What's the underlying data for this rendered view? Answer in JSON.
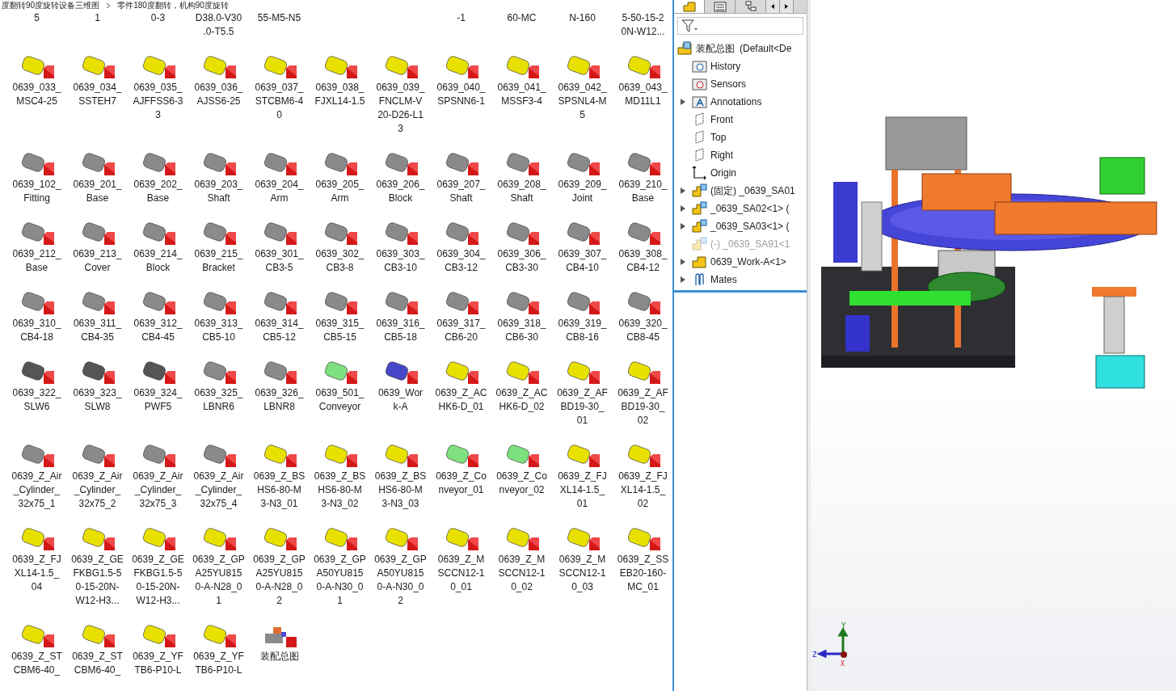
{
  "breadcrumb": [
    "度翻转90度旋转设备三维图",
    "零件180度翻转，机构90度旋转"
  ],
  "partial_row_left": [
    {
      "lines": [
        "5"
      ]
    },
    {
      "lines": [
        "1"
      ]
    },
    {
      "lines": [
        "0-3"
      ]
    },
    {
      "lines": [
        "D38.0-V30",
        ".0-T5.5"
      ]
    },
    {
      "lines": [
        "55-M5-N5"
      ]
    }
  ],
  "partial_row_right": [
    {
      "lines": [
        "-1"
      ]
    },
    {
      "lines": [
        "60-MC"
      ]
    },
    {
      "lines": [
        "N-160"
      ]
    },
    {
      "lines": [
        "5-50-15-2",
        "0N-W12..."
      ]
    }
  ],
  "files": [
    {
      "kind": "part",
      "color": "#e8e000",
      "lines": [
        "0639_033_",
        "MSC4-25"
      ]
    },
    {
      "kind": "part",
      "color": "#e8e000",
      "lines": [
        "0639_034_",
        "SSTEH7"
      ]
    },
    {
      "kind": "part",
      "color": "#e8e000",
      "lines": [
        "0639_035_",
        "AJFFSS6-3",
        "3"
      ]
    },
    {
      "kind": "part",
      "color": "#e8e000",
      "lines": [
        "0639_036_",
        "AJSS6-25"
      ]
    },
    {
      "kind": "part",
      "color": "#e8e000",
      "lines": [
        "0639_037_",
        "STCBM6-4",
        "0"
      ]
    },
    {
      "kind": "part",
      "color": "#e8e000",
      "lines": [
        "0639_038_",
        "FJXL14-1.5"
      ]
    },
    {
      "kind": "part",
      "color": "#e8e000",
      "lines": [
        "0639_039_",
        "FNCLM-V",
        "20-D26-L1",
        "3"
      ]
    },
    {
      "kind": "part",
      "color": "#e8e000",
      "lines": [
        "0639_040_",
        "SPSNN6-1"
      ]
    },
    {
      "kind": "part",
      "color": "#e8e000",
      "lines": [
        "0639_041_",
        "MSSF3-4"
      ]
    },
    {
      "kind": "part",
      "color": "#e8e000",
      "lines": [
        "0639_042_",
        "SPSNL4-M",
        "5"
      ]
    },
    {
      "kind": "part",
      "color": "#e8e000",
      "lines": [
        "0639_043_",
        "MD11L1"
      ]
    },
    {
      "kind": "part",
      "color": "#8a8a8a",
      "lines": [
        "0639_102_",
        "Fitting"
      ]
    },
    {
      "kind": "part",
      "color": "#8a8a8a",
      "lines": [
        "0639_201_",
        "Base"
      ]
    },
    {
      "kind": "part",
      "color": "#8a8a8a",
      "lines": [
        "0639_202_",
        "Base"
      ]
    },
    {
      "kind": "part",
      "color": "#8a8a8a",
      "lines": [
        "0639_203_",
        "Shaft"
      ]
    },
    {
      "kind": "part",
      "color": "#8a8a8a",
      "lines": [
        "0639_204_",
        "Arm"
      ]
    },
    {
      "kind": "part",
      "color": "#8a8a8a",
      "lines": [
        "0639_205_",
        "Arm"
      ]
    },
    {
      "kind": "part",
      "color": "#8a8a8a",
      "lines": [
        "0639_206_",
        "Block"
      ]
    },
    {
      "kind": "part",
      "color": "#8a8a8a",
      "lines": [
        "0639_207_",
        "Shaft"
      ]
    },
    {
      "kind": "part",
      "color": "#8a8a8a",
      "lines": [
        "0639_208_",
        "Shaft"
      ]
    },
    {
      "kind": "part",
      "color": "#8a8a8a",
      "lines": [
        "0639_209_",
        "Joint"
      ]
    },
    {
      "kind": "part",
      "color": "#8a8a8a",
      "lines": [
        "0639_210_",
        "Base"
      ]
    },
    {
      "kind": "part",
      "color": "#8a8a8a",
      "lines": [
        "0639_212_",
        "Base"
      ]
    },
    {
      "kind": "part",
      "color": "#8a8a8a",
      "lines": [
        "0639_213_",
        "Cover"
      ]
    },
    {
      "kind": "part",
      "color": "#8a8a8a",
      "lines": [
        "0639_214_",
        "Block"
      ]
    },
    {
      "kind": "part",
      "color": "#8a8a8a",
      "lines": [
        "0639_215_",
        "Bracket"
      ]
    },
    {
      "kind": "part",
      "color": "#8a8a8a",
      "lines": [
        "0639_301_",
        "CB3-5"
      ]
    },
    {
      "kind": "part",
      "color": "#8a8a8a",
      "lines": [
        "0639_302_",
        "CB3-8"
      ]
    },
    {
      "kind": "part",
      "color": "#8a8a8a",
      "lines": [
        "0639_303_",
        "CB3-10"
      ]
    },
    {
      "kind": "part",
      "color": "#8a8a8a",
      "lines": [
        "0639_304_",
        "CB3-12"
      ]
    },
    {
      "kind": "part",
      "color": "#8a8a8a",
      "lines": [
        "0639_306_",
        "CB3-30"
      ]
    },
    {
      "kind": "part",
      "color": "#8a8a8a",
      "lines": [
        "0639_307_",
        "CB4-10"
      ]
    },
    {
      "kind": "part",
      "color": "#8a8a8a",
      "lines": [
        "0639_308_",
        "CB4-12"
      ]
    },
    {
      "kind": "part",
      "color": "#8a8a8a",
      "lines": [
        "0639_310_",
        "CB4-18"
      ]
    },
    {
      "kind": "part",
      "color": "#8a8a8a",
      "lines": [
        "0639_311_",
        "CB4-35"
      ]
    },
    {
      "kind": "part",
      "color": "#8a8a8a",
      "lines": [
        "0639_312_",
        "CB4-45"
      ]
    },
    {
      "kind": "part",
      "color": "#8a8a8a",
      "lines": [
        "0639_313_",
        "CB5-10"
      ]
    },
    {
      "kind": "part",
      "color": "#8a8a8a",
      "lines": [
        "0639_314_",
        "CB5-12"
      ]
    },
    {
      "kind": "part",
      "color": "#8a8a8a",
      "lines": [
        "0639_315_",
        "CB5-15"
      ]
    },
    {
      "kind": "part",
      "color": "#8a8a8a",
      "lines": [
        "0639_316_",
        "CB5-18"
      ]
    },
    {
      "kind": "part",
      "color": "#8a8a8a",
      "lines": [
        "0639_317_",
        "CB6-20"
      ]
    },
    {
      "kind": "part",
      "color": "#8a8a8a",
      "lines": [
        "0639_318_",
        "CB6-30"
      ]
    },
    {
      "kind": "part",
      "color": "#8a8a8a",
      "lines": [
        "0639_319_",
        "CB8-16"
      ]
    },
    {
      "kind": "part",
      "color": "#8a8a8a",
      "lines": [
        "0639_320_",
        "CB8-45"
      ]
    },
    {
      "kind": "part",
      "color": "#555555",
      "lines": [
        "0639_322_",
        "SLW6"
      ]
    },
    {
      "kind": "part",
      "color": "#555555",
      "lines": [
        "0639_323_",
        "SLW8"
      ]
    },
    {
      "kind": "part",
      "color": "#555555",
      "lines": [
        "0639_324_",
        "PWF5"
      ]
    },
    {
      "kind": "part",
      "color": "#8a8a8a",
      "lines": [
        "0639_325_",
        "LBNR6"
      ]
    },
    {
      "kind": "part",
      "color": "#8a8a8a",
      "lines": [
        "0639_326_",
        "LBNR8"
      ]
    },
    {
      "kind": "part",
      "color": "#7ee07e",
      "lines": [
        "0639_501_",
        "Conveyor"
      ]
    },
    {
      "kind": "part",
      "color": "#4646c8",
      "lines": [
        "0639_Wor",
        "k-A"
      ]
    },
    {
      "kind": "part",
      "color": "#e8e000",
      "lines": [
        "0639_Z_AC",
        "HK6-D_01"
      ]
    },
    {
      "kind": "part",
      "color": "#e8e000",
      "lines": [
        "0639_Z_AC",
        "HK6-D_02"
      ]
    },
    {
      "kind": "part",
      "color": "#e8e000",
      "lines": [
        "0639_Z_AF",
        "BD19-30_",
        "01"
      ]
    },
    {
      "kind": "part",
      "color": "#e8e000",
      "lines": [
        "0639_Z_AF",
        "BD19-30_",
        "02"
      ]
    },
    {
      "kind": "part",
      "color": "#8a8a8a",
      "lines": [
        "0639_Z_Air",
        "_Cylinder_",
        "32x75_1"
      ]
    },
    {
      "kind": "part",
      "color": "#8a8a8a",
      "lines": [
        "0639_Z_Air",
        "_Cylinder_",
        "32x75_2"
      ]
    },
    {
      "kind": "part",
      "color": "#8a8a8a",
      "lines": [
        "0639_Z_Air",
        "_Cylinder_",
        "32x75_3"
      ]
    },
    {
      "kind": "part",
      "color": "#8a8a8a",
      "lines": [
        "0639_Z_Air",
        "_Cylinder_",
        "32x75_4"
      ]
    },
    {
      "kind": "part",
      "color": "#e8e000",
      "lines": [
        "0639_Z_BS",
        "HS6-80-M",
        "3-N3_01"
      ]
    },
    {
      "kind": "part",
      "color": "#e8e000",
      "lines": [
        "0639_Z_BS",
        "HS6-80-M",
        "3-N3_02"
      ]
    },
    {
      "kind": "part",
      "color": "#e8e000",
      "lines": [
        "0639_Z_BS",
        "HS6-80-M",
        "3-N3_03"
      ]
    },
    {
      "kind": "part",
      "color": "#7ee07e",
      "lines": [
        "0639_Z_Co",
        "nveyor_01"
      ]
    },
    {
      "kind": "part",
      "color": "#7ee07e",
      "lines": [
        "0639_Z_Co",
        "nveyor_02"
      ]
    },
    {
      "kind": "part",
      "color": "#e8e000",
      "lines": [
        "0639_Z_FJ",
        "XL14-1.5_",
        "01"
      ]
    },
    {
      "kind": "part",
      "color": "#e8e000",
      "lines": [
        "0639_Z_FJ",
        "XL14-1.5_",
        "02"
      ]
    },
    {
      "kind": "part",
      "color": "#e8e000",
      "lines": [
        "0639_Z_FJ",
        "XL14-1.5_",
        "04"
      ]
    },
    {
      "kind": "part",
      "color": "#e8e000",
      "lines": [
        "0639_Z_GE",
        "FKBG1.5-5",
        "0-15-20N-",
        "W12-H3..."
      ]
    },
    {
      "kind": "part",
      "color": "#e8e000",
      "lines": [
        "0639_Z_GE",
        "FKBG1.5-5",
        "0-15-20N-",
        "W12-H3..."
      ]
    },
    {
      "kind": "part",
      "color": "#e8e000",
      "lines": [
        "0639_Z_GP",
        "A25YU815",
        "0-A-N28_0",
        "1"
      ]
    },
    {
      "kind": "part",
      "color": "#e8e000",
      "lines": [
        "0639_Z_GP",
        "A25YU815",
        "0-A-N28_0",
        "2"
      ]
    },
    {
      "kind": "part",
      "color": "#e8e000",
      "lines": [
        "0639_Z_GP",
        "A50YU815",
        "0-A-N30_0",
        "1"
      ]
    },
    {
      "kind": "part",
      "color": "#e8e000",
      "lines": [
        "0639_Z_GP",
        "A50YU815",
        "0-A-N30_0",
        "2"
      ]
    },
    {
      "kind": "part",
      "color": "#e8e000",
      "lines": [
        "0639_Z_M",
        "SCCN12-1",
        "0_01"
      ]
    },
    {
      "kind": "part",
      "color": "#e8e000",
      "lines": [
        "0639_Z_M",
        "SCCN12-1",
        "0_02"
      ]
    },
    {
      "kind": "part",
      "color": "#e8e000",
      "lines": [
        "0639_Z_M",
        "SCCN12-1",
        "0_03"
      ]
    },
    {
      "kind": "part",
      "color": "#e8e000",
      "lines": [
        "0639_Z_SS",
        "EB20-160-",
        "MC_01"
      ]
    },
    {
      "kind": "part",
      "color": "#e8e000",
      "lines": [
        "0639_Z_ST",
        "CBM6-40_"
      ]
    },
    {
      "kind": "part",
      "color": "#e8e000",
      "lines": [
        "0639_Z_ST",
        "CBM6-40_"
      ]
    },
    {
      "kind": "part",
      "color": "#e8e000",
      "lines": [
        "0639_Z_YF",
        "TB6-P10-L"
      ]
    },
    {
      "kind": "part",
      "color": "#e8e000",
      "lines": [
        "0639_Z_YF",
        "TB6-P10-L"
      ]
    },
    {
      "kind": "assembly",
      "color": "#8a8a8a",
      "lines": [
        "装配总图"
      ]
    }
  ],
  "tree_tabs": [
    {
      "kind": "feature",
      "selected": true
    },
    {
      "kind": "property",
      "selected": false
    },
    {
      "kind": "config",
      "selected": false
    }
  ],
  "tree_root": {
    "name": "装配总图",
    "config": "(Default<De"
  },
  "tree": [
    {
      "kind": "history",
      "label": "History",
      "expandable": false,
      "suppressed": false
    },
    {
      "kind": "sensors",
      "label": "Sensors",
      "expandable": false,
      "suppressed": false
    },
    {
      "kind": "annotations",
      "label": "Annotations",
      "expandable": true,
      "suppressed": false
    },
    {
      "kind": "plane",
      "label": "Front",
      "expandable": false,
      "suppressed": false
    },
    {
      "kind": "plane",
      "label": "Top",
      "expandable": false,
      "suppressed": false
    },
    {
      "kind": "plane",
      "label": "Right",
      "expandable": false,
      "suppressed": false
    },
    {
      "kind": "origin",
      "label": "Origin",
      "expandable": false,
      "suppressed": false
    },
    {
      "kind": "subassembly",
      "label": "(固定) _0639_SA01",
      "expandable": true,
      "suppressed": false
    },
    {
      "kind": "subassembly",
      "label": "_0639_SA02<1> (",
      "expandable": true,
      "suppressed": false
    },
    {
      "kind": "subassembly",
      "label": "_0639_SA03<1> (",
      "expandable": true,
      "suppressed": false
    },
    {
      "kind": "subassembly",
      "label": "(-) _0639_SA91<1",
      "expandable": false,
      "suppressed": true
    },
    {
      "kind": "part",
      "label": "0639_Work-A<1>",
      "expandable": true,
      "suppressed": false
    },
    {
      "kind": "mates",
      "label": "Mates",
      "expandable": true,
      "suppressed": false
    }
  ],
  "triad": {
    "y": "Y",
    "z": "Z",
    "x": "X"
  }
}
